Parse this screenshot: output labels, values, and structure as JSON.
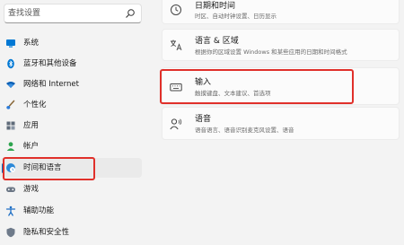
{
  "search": {
    "placeholder": "查找设置"
  },
  "sidebar": {
    "items": [
      {
        "label": "系统",
        "icon": "system-icon"
      },
      {
        "label": "蓝牙和其他设备",
        "icon": "bluetooth-icon"
      },
      {
        "label": "网络和 Internet",
        "icon": "wifi-icon"
      },
      {
        "label": "个性化",
        "icon": "brush-icon"
      },
      {
        "label": "应用",
        "icon": "apps-icon"
      },
      {
        "label": "帐户",
        "icon": "account-icon"
      },
      {
        "label": "时间和语言",
        "icon": "globe-clock-icon",
        "selected": true
      },
      {
        "label": "游戏",
        "icon": "game-controller-icon"
      },
      {
        "label": "辅助功能",
        "icon": "accessibility-icon"
      },
      {
        "label": "隐私和安全性",
        "icon": "shield-icon"
      }
    ]
  },
  "main": {
    "cards": [
      {
        "title": "日期和时间",
        "subtitle": "时区、自动时钟设置、日历显示",
        "icon": "clock-icon"
      },
      {
        "title": "语言 & 区域",
        "subtitle": "根据你的区域设置 Windows 和某些应用的日期和时间格式",
        "icon": "language-icon"
      },
      {
        "title": "输入",
        "subtitle": "触摸键盘、文本建议、首选项",
        "icon": "keyboard-icon"
      },
      {
        "title": "语音",
        "subtitle": "语音语言、语音识别麦克风设置、语音",
        "icon": "speech-icon"
      }
    ]
  },
  "colors": {
    "accent": "#0067c0",
    "highlight": "#e0302a",
    "background": "#f3f3f3",
    "card": "#fbfbfb"
  }
}
